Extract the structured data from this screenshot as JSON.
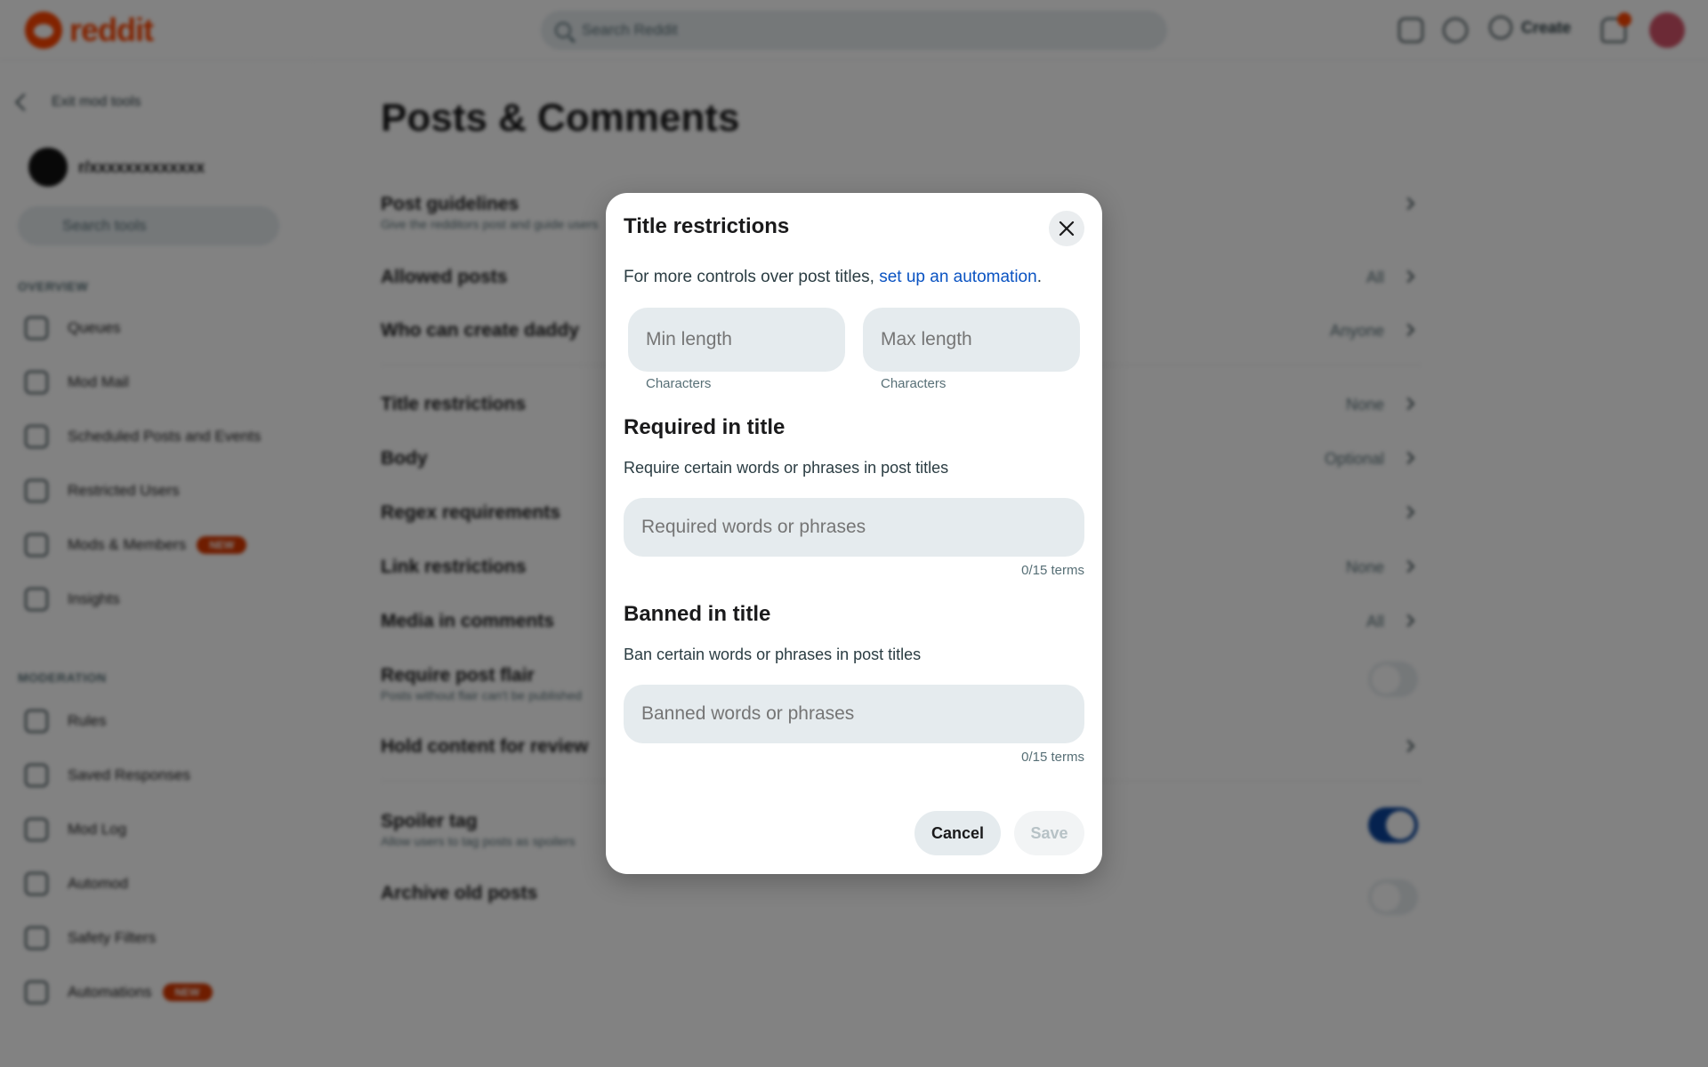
{
  "topbar": {
    "logo_text": "reddit",
    "search_placeholder": "Search Reddit",
    "create_label": "Create"
  },
  "sidebar": {
    "back_label": "Exit mod tools",
    "community_name": "r/xxxxxxxxxxxxx",
    "search_placeholder": "Search tools",
    "sections": [
      {
        "title": "OVERVIEW",
        "items": [
          {
            "label": "Queues",
            "icon": "queue-icon"
          },
          {
            "label": "Mod Mail",
            "icon": "mail-icon"
          },
          {
            "label": "Scheduled Posts and Events",
            "icon": "calendar-icon"
          },
          {
            "label": "Restricted Users",
            "icon": "restricted-icon"
          },
          {
            "label": "Mods & Members",
            "icon": "members-icon",
            "badge": "NEW"
          },
          {
            "label": "Insights",
            "icon": "insights-icon"
          }
        ]
      },
      {
        "title": "MODERATION",
        "items": [
          {
            "label": "Rules",
            "icon": "rules-icon"
          },
          {
            "label": "Saved Responses",
            "icon": "responses-icon"
          },
          {
            "label": "Mod Log",
            "icon": "log-icon"
          },
          {
            "label": "Automod",
            "icon": "automod-icon"
          },
          {
            "label": "Safety Filters",
            "icon": "shield-icon"
          },
          {
            "label": "Automations",
            "icon": "automation-icon",
            "badge": "NEW"
          }
        ]
      }
    ]
  },
  "main": {
    "page_title": "Posts & Comments",
    "settings": [
      {
        "label": "Post guidelines",
        "sub": "Give the redditors post and guide users",
        "value": "",
        "control": "chevron"
      },
      {
        "label": "Allowed posts",
        "value": "All",
        "control": "chevron"
      },
      {
        "label": "Who can create daddy",
        "value": "Anyone",
        "control": "chevron"
      },
      {
        "label": "Title restrictions",
        "value": "None",
        "control": "chevron"
      },
      {
        "label": "Body",
        "value": "Optional",
        "control": "chevron"
      },
      {
        "label": "Regex requirements",
        "value": "",
        "control": "chevron"
      },
      {
        "label": "Link restrictions",
        "value": "None",
        "control": "chevron"
      },
      {
        "label": "Media in comments",
        "value": "All",
        "control": "chevron"
      },
      {
        "label": "Require post flair",
        "sub": "Posts without flair can't be published",
        "value": "",
        "control": "toggle-off"
      },
      {
        "label": "Hold content for review",
        "value": "",
        "control": "chevron"
      },
      {
        "label": "Spoiler tag",
        "sub": "Allow users to tag posts as spoilers",
        "value": "",
        "control": "toggle-on"
      },
      {
        "label": "Archive old posts",
        "value": "",
        "control": "toggle-off"
      }
    ]
  },
  "modal": {
    "title": "Title restrictions",
    "intro_text": "For more controls over post titles, ",
    "intro_link": "set up an automation",
    "intro_end": ".",
    "min_length": {
      "placeholder": "Min length",
      "value": "",
      "helper": "Characters"
    },
    "max_length": {
      "placeholder": "Max length",
      "value": "",
      "helper": "Characters"
    },
    "required": {
      "heading": "Required in title",
      "description": "Require certain words or phrases in post titles",
      "placeholder": "Required words or phrases",
      "value": "",
      "count": "0/15 terms"
    },
    "banned": {
      "heading": "Banned in title",
      "description": "Ban certain words or phrases in post titles",
      "placeholder": "Banned words or phrases",
      "value": "",
      "count": "0/15 terms"
    },
    "cancel_label": "Cancel",
    "save_label": "Save"
  },
  "colors": {
    "brand": "#ff4500",
    "link": "#0a53c2",
    "toggle_on": "#0a449b",
    "badge_new": "#d93900"
  }
}
